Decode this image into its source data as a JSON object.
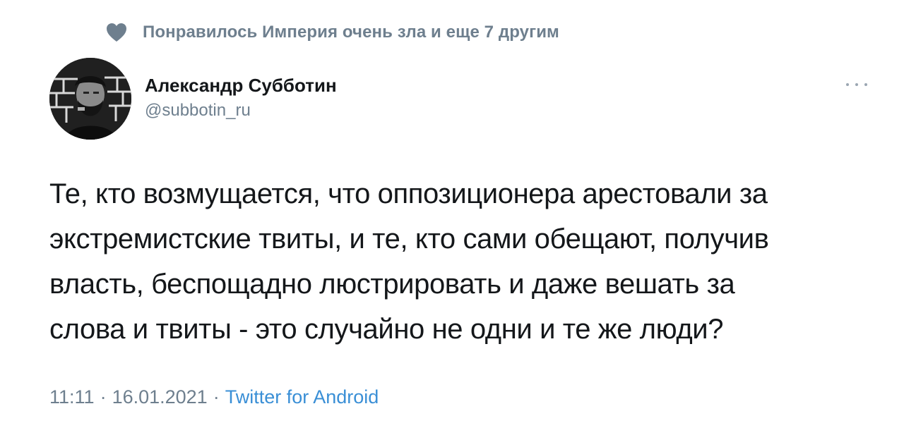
{
  "social_context": {
    "icon": "heart-icon",
    "text": "Понравилось Империя очень зла и еще 7 другим"
  },
  "author": {
    "name": "Александр Субботин",
    "handle": "@subbotin_ru"
  },
  "tweet": {
    "text": "Те, кто возмущается, что оппозиционера арестовали за\nэкстремистские твиты, и те, кто сами обещают, получив\nвласть, беспощадно люстрировать и даже вешать за\nслова и твиты - это случайно не одни и те же люди?"
  },
  "meta": {
    "time": "11:11",
    "separator": "·",
    "date": "16.01.2021",
    "source": "Twitter for Android"
  },
  "colors": {
    "muted": "#6e7f8e",
    "link": "#3a8fd6",
    "text": "#14171a"
  }
}
